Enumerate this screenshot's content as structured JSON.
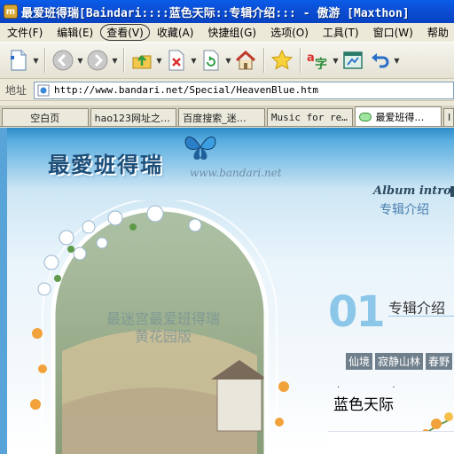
{
  "window": {
    "title": "最爱班得瑞[Baindari::::蓝色天际::专辑介绍::: - 傲游 [Maxthon]",
    "app_icon": "m"
  },
  "menu": {
    "items": [
      "文件(F)",
      "编辑(E)",
      "查看(V)",
      "收藏(A)",
      "快捷组(G)",
      "选项(O)",
      "工具(T)",
      "窗口(W)",
      "帮助"
    ]
  },
  "toolbar": {
    "buttons": [
      {
        "icon": "new-document-icon",
        "has_dropdown": true
      },
      {
        "icon": "back-icon",
        "has_dropdown": true
      },
      {
        "icon": "forward-icon",
        "has_dropdown": true
      },
      {
        "icon": "up-folder-icon",
        "has_dropdown": true
      },
      {
        "icon": "stop-icon",
        "has_dropdown": true
      },
      {
        "icon": "refresh-icon",
        "has_dropdown": true
      },
      {
        "icon": "home-icon",
        "has_dropdown": false
      },
      {
        "icon": "favorites-star-icon",
        "has_dropdown": false
      },
      {
        "icon": "translate-icon",
        "has_dropdown": true
      },
      {
        "icon": "window-icon",
        "has_dropdown": false
      },
      {
        "icon": "undo-icon",
        "has_dropdown": true
      }
    ]
  },
  "address": {
    "label": "地址",
    "url": "http://www.bandari.net/Special/HeavenBlue.htm"
  },
  "tabs": [
    {
      "label": "空白页",
      "active": false
    },
    {
      "label": "hao123网址之…",
      "active": false
    },
    {
      "label": "百度搜索_迷…",
      "active": false
    },
    {
      "label": "Music for re…",
      "active": false
    },
    {
      "label": "最爱班得…",
      "active": true
    },
    {
      "label": "I",
      "active": false
    }
  ],
  "page": {
    "site_logo": "最愛班得瑞",
    "site_url": "www.bandari.net",
    "art_caption_line1": "最迷宫最爱班得瑞",
    "art_caption_line2": "黄花园版",
    "album_en": "Album intro",
    "album_cn": "专辑介绍",
    "section_number": "01",
    "section_title": "专辑介绍",
    "tracks": [
      "仙境",
      "寂静山林",
      "春野"
    ],
    "song_title": "蓝色天际",
    "accent_color": "#8cc7ea"
  }
}
